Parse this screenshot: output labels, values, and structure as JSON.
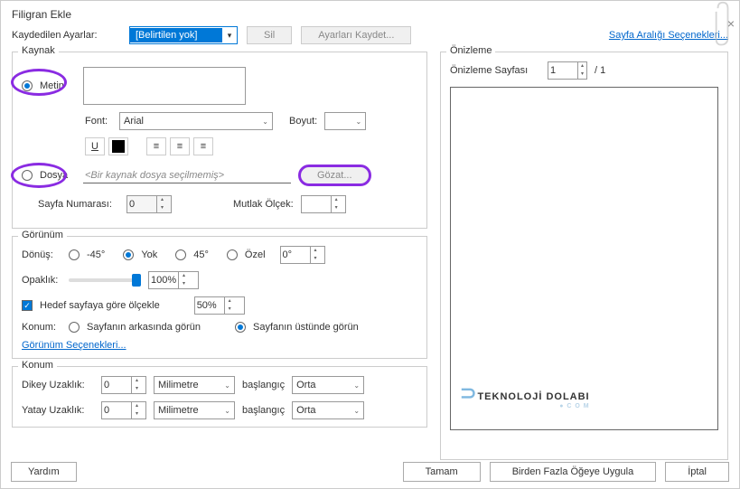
{
  "title": "Filigran Ekle",
  "savedLabel": "Kaydedilen Ayarlar:",
  "savedValue": "[Belirtilen yok]",
  "deleteBtn": "Sil",
  "saveSettingsBtn": "Ayarları Kaydet...",
  "pageRangeLink": "Sayfa Aralığı Seçenekleri...",
  "source": {
    "legend": "Kaynak",
    "textRadio": "Metin",
    "fontLabel": "Font:",
    "fontValue": "Arial",
    "sizeLabel": "Boyut:",
    "fileRadio": "Dosya",
    "filePath": "<Bir kaynak dosya seçilmemiş>",
    "browseBtn": "Gözat...",
    "pageNumLabel": "Sayfa Numarası:",
    "pageNumValue": "0",
    "absScaleLabel": "Mutlak Ölçek:"
  },
  "appearance": {
    "legend": "Görünüm",
    "rotationLabel": "Dönüş:",
    "rotNeg45": "-45°",
    "rotNone": "Yok",
    "rot45": "45°",
    "rotCustom": "Özel",
    "rotValue": "0°",
    "opacityLabel": "Opaklık:",
    "opacityValue": "100%",
    "scaleCheck": "Hedef sayfaya göre ölçekle",
    "scaleValue": "50%",
    "locationLabel": "Konum:",
    "locBehind": "Sayfanın arkasında görün",
    "locFront": "Sayfanın üstünde görün",
    "optionsLink": "Görünüm Seçenekleri..."
  },
  "position": {
    "legend": "Konum",
    "vertLabel": "Dikey Uzaklık:",
    "vertValue": "0",
    "horizLabel": "Yatay Uzaklık:",
    "horizValue": "0",
    "unit": "Milimetre",
    "fromLabel": "başlangıç",
    "fromValue": "Orta"
  },
  "preview": {
    "legend": "Önizleme",
    "pageLabel": "Önizleme Sayfası",
    "pageValue": "1",
    "pageTotal": "/ 1"
  },
  "buttons": {
    "help": "Yardım",
    "ok": "Tamam",
    "applyMultiple": "Birden Fazla Öğeye Uygula",
    "cancel": "İptal"
  },
  "brand": "TEKNOLOJİ DOLABI"
}
